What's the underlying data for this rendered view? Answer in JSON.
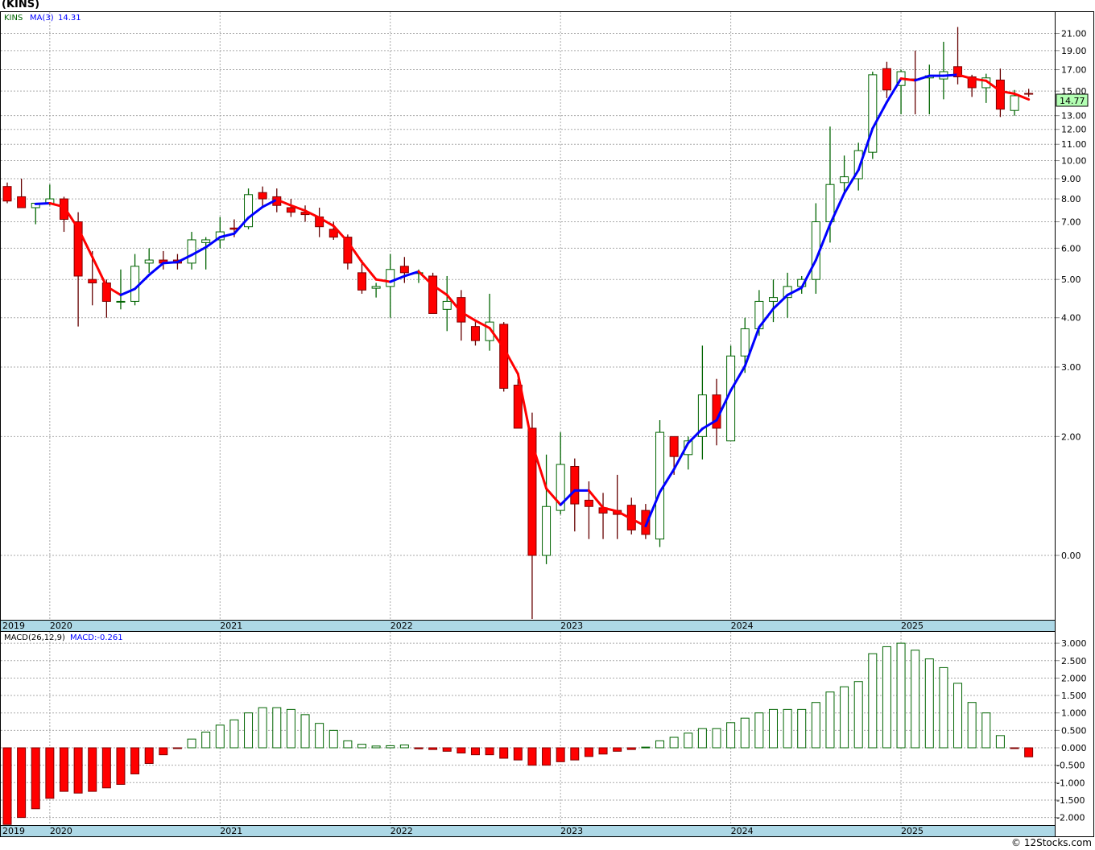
{
  "title": "(KINS)",
  "legend": {
    "symbol": "KINS",
    "ma_label": "MA(3)",
    "ma_value": "14.31"
  },
  "last_price_tag": "14.77",
  "macd_legend": {
    "label": "MACD(26,12,9)",
    "value": "MACD:-0.261"
  },
  "footer": "© 12Stocks.com",
  "colors": {
    "up": "#006400",
    "down": "#ff0000",
    "ma_up": "#0000ff",
    "ma_down": "#ff0000",
    "axis_strip": "#add8e6",
    "tag_bg": "#b3ffb3"
  },
  "chart_data": [
    {
      "type": "candlestick",
      "title": "(KINS)",
      "scale": "log",
      "interval": "monthly",
      "x_ticks": [
        "2019",
        "2020",
        "2021",
        "2022",
        "2023",
        "2024",
        "2025"
      ],
      "y_ticks": [
        {
          "value": 21,
          "label": "21.00"
        },
        {
          "value": 19,
          "label": "19.00"
        },
        {
          "value": 17,
          "label": "17.00"
        },
        {
          "value": 15,
          "label": "15.00"
        },
        {
          "value": 13,
          "label": "13.00"
        },
        {
          "value": 12,
          "label": "12.00"
        },
        {
          "value": 11,
          "label": "11.00"
        },
        {
          "value": 10,
          "label": "10.00"
        },
        {
          "value": 9,
          "label": "9.00"
        },
        {
          "value": 8,
          "label": "8.00"
        },
        {
          "value": 7,
          "label": "7.00"
        },
        {
          "value": 6,
          "label": "6.00"
        },
        {
          "value": 5,
          "label": "5.00"
        },
        {
          "value": 4,
          "label": "4.00"
        },
        {
          "value": 3,
          "label": "3.00"
        },
        {
          "value": 2,
          "label": "2.00"
        },
        {
          "value": 1,
          "label": "0.00"
        }
      ],
      "ma_period": 3,
      "ohlc": [
        [
          8.6,
          8.8,
          7.8,
          7.9
        ],
        [
          8.1,
          9.0,
          7.6,
          7.6
        ],
        [
          7.6,
          7.8,
          6.9,
          7.8
        ],
        [
          7.8,
          8.7,
          7.7,
          8.0
        ],
        [
          8.0,
          8.1,
          6.6,
          7.1
        ],
        [
          7.0,
          7.4,
          3.8,
          5.1
        ],
        [
          5.0,
          5.9,
          4.3,
          4.9
        ],
        [
          4.9,
          5.0,
          4.0,
          4.4
        ],
        [
          4.4,
          5.3,
          4.2,
          4.4
        ],
        [
          4.4,
          5.8,
          4.3,
          5.4
        ],
        [
          5.5,
          6.0,
          5.2,
          5.6
        ],
        [
          5.6,
          5.9,
          5.3,
          5.5
        ],
        [
          5.6,
          5.8,
          5.3,
          5.5
        ],
        [
          5.5,
          6.6,
          5.3,
          6.3
        ],
        [
          6.2,
          6.4,
          5.3,
          6.3
        ],
        [
          6.3,
          7.2,
          6.0,
          6.6
        ],
        [
          6.75,
          7.1,
          6.4,
          6.7
        ],
        [
          6.8,
          8.5,
          6.7,
          8.2
        ],
        [
          8.3,
          8.6,
          7.6,
          8.0
        ],
        [
          8.1,
          8.5,
          7.4,
          7.7
        ],
        [
          7.6,
          8.0,
          7.2,
          7.4
        ],
        [
          7.4,
          7.7,
          7.0,
          7.3
        ],
        [
          7.2,
          7.6,
          6.4,
          6.8
        ],
        [
          6.7,
          7.0,
          6.3,
          6.4
        ],
        [
          6.4,
          6.5,
          5.3,
          5.5
        ],
        [
          5.2,
          5.6,
          4.6,
          4.7
        ],
        [
          4.75,
          4.9,
          4.5,
          4.8
        ],
        [
          4.8,
          5.8,
          4.0,
          5.3
        ],
        [
          5.4,
          5.7,
          4.9,
          5.2
        ],
        [
          5.2,
          5.3,
          4.9,
          5.2
        ],
        [
          5.1,
          5.2,
          4.1,
          4.1
        ],
        [
          4.2,
          5.1,
          3.7,
          4.4
        ],
        [
          4.5,
          4.7,
          3.5,
          3.9
        ],
        [
          3.8,
          3.9,
          3.4,
          3.5
        ],
        [
          3.5,
          4.6,
          3.3,
          3.9
        ],
        [
          3.85,
          3.9,
          2.6,
          2.65
        ],
        [
          2.7,
          2.8,
          2.1,
          2.1
        ],
        [
          2.1,
          2.3,
          0.69,
          1.0
        ],
        [
          1.0,
          1.8,
          0.95,
          1.33
        ],
        [
          1.3,
          2.05,
          1.27,
          1.7
        ],
        [
          1.68,
          1.76,
          1.15,
          1.35
        ],
        [
          1.38,
          1.54,
          1.1,
          1.33
        ],
        [
          1.32,
          1.44,
          1.1,
          1.28
        ],
        [
          1.3,
          1.6,
          1.1,
          1.27
        ],
        [
          1.34,
          1.4,
          1.13,
          1.16
        ],
        [
          1.3,
          1.35,
          1.1,
          1.13
        ],
        [
          1.1,
          2.2,
          1.05,
          2.05
        ],
        [
          2.0,
          2.0,
          1.6,
          1.78
        ],
        [
          1.8,
          2.0,
          1.65,
          1.95
        ],
        [
          2.0,
          3.4,
          1.75,
          2.55
        ],
        [
          2.55,
          2.8,
          1.9,
          2.1
        ],
        [
          1.95,
          3.4,
          1.95,
          3.2
        ],
        [
          3.2,
          4.0,
          2.9,
          3.75
        ],
        [
          3.75,
          4.7,
          3.6,
          4.4
        ],
        [
          4.4,
          5.0,
          3.9,
          4.5
        ],
        [
          4.5,
          5.2,
          4.0,
          4.8
        ],
        [
          4.8,
          5.1,
          4.6,
          5.0
        ],
        [
          5.0,
          7.8,
          4.6,
          7.0
        ],
        [
          7.0,
          12.2,
          6.2,
          8.7
        ],
        [
          8.8,
          10.3,
          8.3,
          9.1
        ],
        [
          9.0,
          11.1,
          8.4,
          10.6
        ],
        [
          10.5,
          16.8,
          10.1,
          16.5
        ],
        [
          17.1,
          17.8,
          14.4,
          15.1
        ],
        [
          15.5,
          17.0,
          13.1,
          16.8
        ],
        [
          16.1,
          19.0,
          13.1,
          16.0
        ],
        [
          16.2,
          17.5,
          13.1,
          16.4
        ],
        [
          16.1,
          20.0,
          14.3,
          16.8
        ],
        [
          17.3,
          21.8,
          15.6,
          16.3
        ],
        [
          16.3,
          16.5,
          14.5,
          15.3
        ],
        [
          15.3,
          16.6,
          14.0,
          16.2
        ],
        [
          16.0,
          17.1,
          12.9,
          13.5
        ],
        [
          13.4,
          15.1,
          13.0,
          14.6
        ],
        [
          14.8,
          15.2,
          14.5,
          14.77
        ]
      ]
    },
    {
      "type": "bar",
      "title": "MACD(26,12,9)",
      "x_ticks": [
        "2019",
        "2020",
        "2021",
        "2022",
        "2023",
        "2024",
        "2025"
      ],
      "y_ticks": [
        "3.000",
        "2.500",
        "2.000",
        "1.500",
        "1.000",
        "0.500",
        "0.000",
        "-0.500",
        "-1.000",
        "-1.500",
        "-2.000"
      ],
      "ylim": [
        -2.2,
        3.2
      ],
      "values": [
        -2.2,
        -2.0,
        -1.75,
        -1.45,
        -1.25,
        -1.3,
        -1.25,
        -1.15,
        -1.05,
        -0.75,
        -0.45,
        -0.2,
        -0.02,
        0.25,
        0.45,
        0.65,
        0.8,
        1.0,
        1.15,
        1.15,
        1.1,
        0.95,
        0.7,
        0.5,
        0.2,
        0.1,
        0.05,
        0.06,
        0.08,
        -0.03,
        -0.05,
        -0.1,
        -0.15,
        -0.2,
        -0.2,
        -0.3,
        -0.35,
        -0.5,
        -0.5,
        -0.4,
        -0.35,
        -0.25,
        -0.18,
        -0.1,
        -0.05,
        0.02,
        0.2,
        0.3,
        0.42,
        0.55,
        0.55,
        0.72,
        0.85,
        1.0,
        1.1,
        1.1,
        1.1,
        1.3,
        1.6,
        1.75,
        1.9,
        2.7,
        2.9,
        3.0,
        2.8,
        2.55,
        2.3,
        1.85,
        1.3,
        1.0,
        0.35,
        -0.02,
        -0.26
      ]
    }
  ]
}
